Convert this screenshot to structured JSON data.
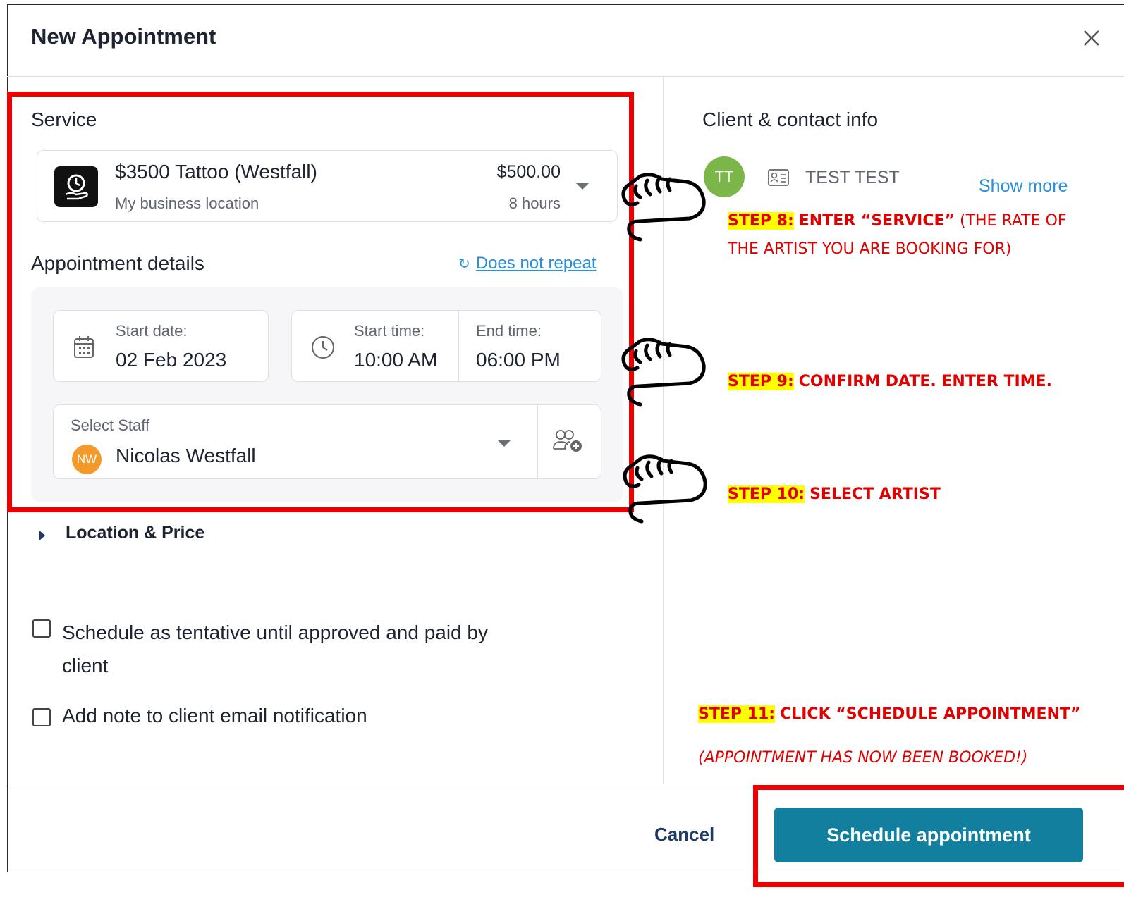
{
  "modal": {
    "title": "New Appointment"
  },
  "service": {
    "heading": "Service",
    "name": "$3500 Tattoo (Westfall)",
    "location": "My business location",
    "price": "$500.00",
    "duration": "8 hours"
  },
  "details": {
    "heading": "Appointment details",
    "repeat_label": "Does not repeat",
    "start_date_label": "Start date:",
    "start_date_value": "02 Feb 2023",
    "start_time_label": "Start time:",
    "start_time_value": "10:00 AM",
    "end_time_label": "End time:",
    "end_time_value": "06:00 PM",
    "staff_label": "Select Staff",
    "staff_initials": "NW",
    "staff_name": "Nicolas Westfall",
    "location_price_label": "Location & Price"
  },
  "options": {
    "tentative_label_line1": "Schedule as tentative until approved and paid by",
    "tentative_label_line2": "client",
    "note_label": "Add note to client email notification"
  },
  "client": {
    "heading": "Client & contact info",
    "initials": "TT",
    "name": "TEST TEST",
    "show_more": "Show more"
  },
  "footer": {
    "cancel_label": "Cancel",
    "schedule_label": "Schedule appointment"
  },
  "annotations": {
    "step8_tag": "STEP 8:",
    "step8_bold": "ENTER “SERVICE”",
    "step8_rest": "(THE RATE OF",
    "step8_line2": "THE ARTIST YOU ARE BOOKING FOR)",
    "step9_tag": "STEP 9:",
    "step9_text": "CONFIRM DATE. ENTER TIME.",
    "step10_tag": "STEP 10:",
    "step10_text": "SELECT ARTIST",
    "step11_tag": "STEP 11:",
    "step11_text": "CLICK “SCHEDULE APPOINTMENT”",
    "step11_note": "(APPOINTMENT HAS NOW BEEN BOOKED!)"
  },
  "colors": {
    "primary_button": "#137f9e",
    "link": "#2a8ed8",
    "annotation_red": "#e00000",
    "highlight": "#ffff00",
    "client_avatar": "#7ab648",
    "staff_avatar": "#f39a2a"
  }
}
